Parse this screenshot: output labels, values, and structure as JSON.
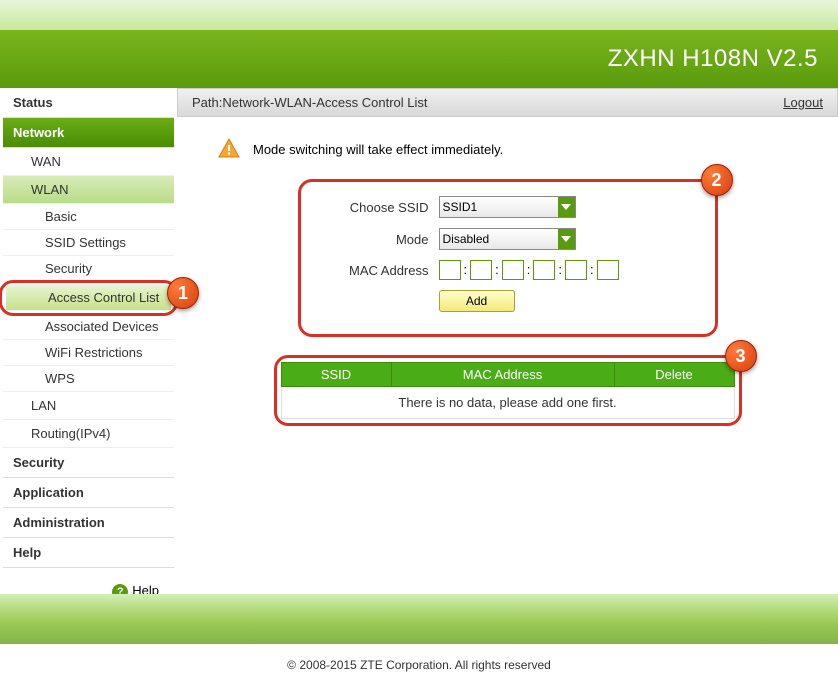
{
  "brand": "ZXHN H108N V2.5",
  "breadcrumb": "Path:Network-WLAN-Access Control List",
  "logout": "Logout",
  "notice": "Mode switching will take effect immediately.",
  "nav": {
    "status": "Status",
    "network": "Network",
    "wan": "WAN",
    "wlan": "WLAN",
    "basic": "Basic",
    "ssid_settings": "SSID Settings",
    "security": "Security",
    "acl": "Access Control List",
    "assoc": "Associated Devices",
    "wifi_restr": "WiFi Restrictions",
    "wps": "WPS",
    "lan": "LAN",
    "routing": "Routing(IPv4)",
    "security_sec": "Security",
    "application": "Application",
    "administration": "Administration",
    "help": "Help",
    "help_link": "Help"
  },
  "form": {
    "choose_ssid": "Choose SSID",
    "ssid_value": "SSID1",
    "mode": "Mode",
    "mode_value": "Disabled",
    "mac": "MAC Address",
    "add": "Add"
  },
  "table": {
    "col_ssid": "SSID",
    "col_mac": "MAC Address",
    "col_delete": "Delete",
    "empty": "There is no data, please add one first."
  },
  "badges": {
    "b1": "1",
    "b2": "2",
    "b3": "3"
  },
  "footer": "© 2008-2015 ZTE Corporation. All rights reserved"
}
